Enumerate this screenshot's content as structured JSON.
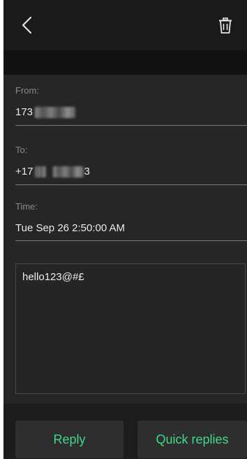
{
  "header": {
    "back_icon": "chevron-left-icon",
    "delete_icon": "trash-icon"
  },
  "fields": {
    "from": {
      "label": "From:",
      "value_prefix": "173"
    },
    "to": {
      "label": "To:",
      "value_prefix": "+17",
      "value_suffix": "3"
    },
    "time": {
      "label": "Time:",
      "value": "Tue Sep 26 2:50:00 AM"
    }
  },
  "message": {
    "body": "hello123@#£"
  },
  "actions": {
    "reply_label": "Reply",
    "quick_replies_label": "Quick replies"
  },
  "colors": {
    "background": "#262626",
    "accent_green": "#3fd98a",
    "label_gray": "#8a8a8a"
  }
}
